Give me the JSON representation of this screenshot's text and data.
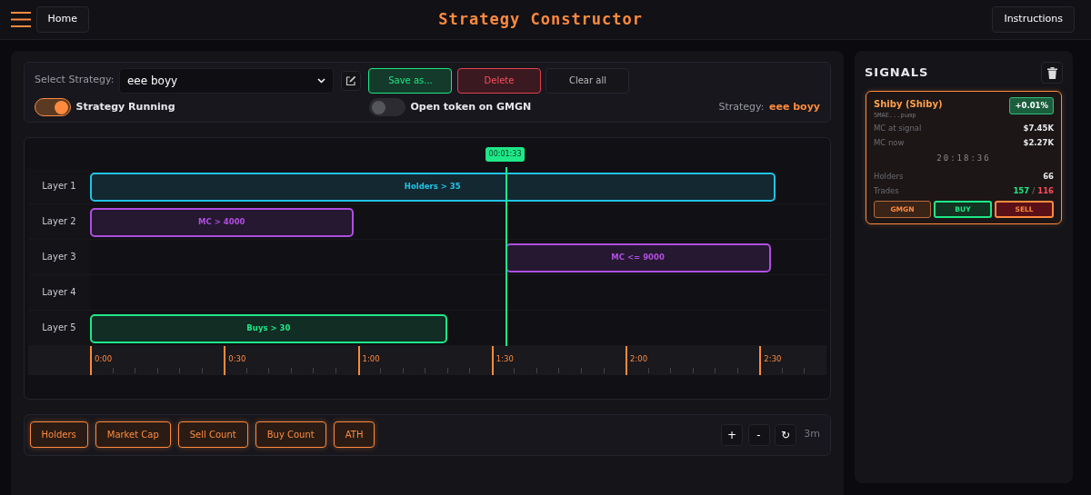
{
  "nav": {
    "home": "Home",
    "title": "Strategy Constructor",
    "instructions": "Instructions"
  },
  "controls": {
    "select_label": "Select Strategy:",
    "selected_strategy": "eee boyy",
    "buttons": [
      {
        "label": "Save as...",
        "kind": "save"
      },
      {
        "label": "Delete",
        "kind": "delete"
      },
      {
        "label": "Clear all",
        "kind": "clear"
      }
    ],
    "toggles": [
      {
        "label": "Strategy Running",
        "on": true
      },
      {
        "label": "Open token on GMGN",
        "on": false
      }
    ],
    "strategy_label": "Strategy:",
    "strategy_name": "eee boyy"
  },
  "timeline": {
    "playhead": "00:01:33",
    "layers": [
      {
        "label": "Layer 1",
        "blocks": [
          {
            "text": "Holders > 35",
            "color": "#22c3e6"
          }
        ]
      },
      {
        "label": "Layer 2",
        "blocks": [
          {
            "text": "MC > 4000",
            "color": "#b04ee0"
          }
        ]
      },
      {
        "label": "Layer 3",
        "blocks": [
          {
            "text": "MC <= 9000",
            "color": "#b04ee0"
          }
        ]
      },
      {
        "label": "Layer 4"
      },
      {
        "label": "Layer 5",
        "blocks": [
          {
            "text": "Buys > 30",
            "color": "#1ee887"
          }
        ]
      }
    ],
    "ticks": [
      "0:00",
      "0:30",
      "1:00",
      "1:30",
      "2:00",
      "2:30"
    ]
  },
  "metric_buttons": [
    "Holders",
    "Market Cap",
    "Sell Count",
    "Buy Count",
    "ATH"
  ],
  "zoom_controls": [
    "+",
    "-",
    "↻"
  ],
  "zoom_level": "3m",
  "signals": {
    "title": "SIGNALS",
    "cards": [
      {
        "name": "Shiby (Shiby)",
        "address": "5MAE...pump",
        "change": "+0.01%",
        "rows": [
          {
            "label": "MC at signal",
            "value": "$7.45K"
          },
          {
            "label": "MC now",
            "value": "$2.27K"
          }
        ],
        "time": "20:18:36",
        "holders_label": "Holders",
        "holders": "66",
        "trades_label": "Trades",
        "buys": "157",
        "trades_separator": "/",
        "sells": "116",
        "actions": [
          {
            "label": "GMGN",
            "kind": "gmgn"
          },
          {
            "label": "BUY",
            "kind": "buy"
          },
          {
            "label": "SELL",
            "kind": "sell"
          }
        ]
      }
    ]
  }
}
